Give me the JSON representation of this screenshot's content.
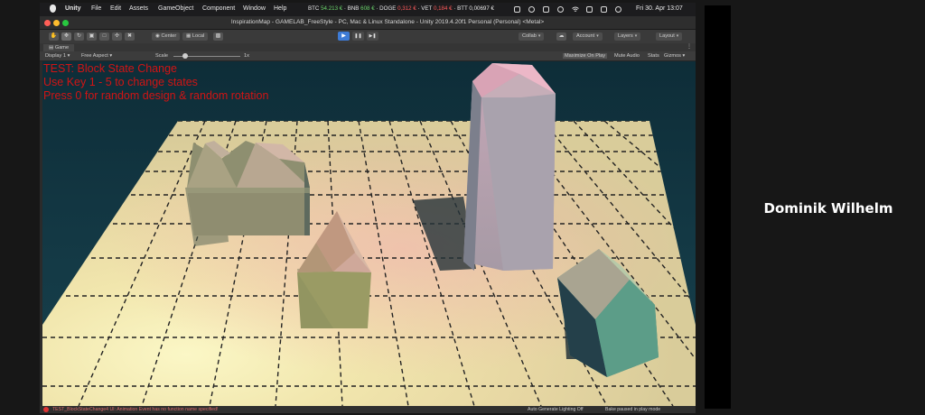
{
  "menubar": {
    "app": "Unity",
    "menus": [
      "File",
      "Edit",
      "Assets",
      "GameObject",
      "Component",
      "Window",
      "Help"
    ],
    "tickers": [
      {
        "symbol": "BTC",
        "value": "54.213 €",
        "trend": "up"
      },
      {
        "symbol": "BNB",
        "value": "608 €",
        "trend": "up"
      },
      {
        "symbol": "DOGE",
        "value": "0,312 €",
        "trend": "down"
      },
      {
        "symbol": "VET",
        "value": "0,184 €",
        "trend": "down"
      },
      {
        "symbol": "BTT",
        "value": "0,00697 €",
        "trend": "neutral"
      }
    ],
    "clock": "Fri 30. Apr 13:07"
  },
  "window": {
    "title": "InspirationMap - GAMELAB_FreeStyle - PC, Mac & Linux Standalone - Unity 2019.4.20f1 Personal (Personal) <Metal>"
  },
  "toolbar": {
    "pivot_label": "Center",
    "space_label": "Local",
    "play_icon": "▶",
    "pause_icon": "❚❚",
    "step_icon": "▶❚",
    "collab_label": "Collab",
    "account_label": "Account",
    "layers_label": "Layers",
    "layout_label": "Layout"
  },
  "game_tab": {
    "tab_label": "Game",
    "display": "Display 1",
    "aspect": "Free Aspect",
    "scale_label": "Scale",
    "scale_value": "1x",
    "maximize": "Maximize On Play",
    "mute": "Mute Audio",
    "stats": "Stats",
    "gizmos": "Gizmos"
  },
  "hud": {
    "line1": "TEST: Block State Change",
    "line2": "Use Key 1 - 5 to change states",
    "line3": "Press 0 for random design & random rotation"
  },
  "statusbar": {
    "error": "TEST_BlockStateChange4 UI: Animation Event has no function name specified!",
    "lighting": "Auto Generate Lighting Off",
    "bake": "Bake paused in play mode"
  },
  "participant": {
    "name": "Dominik Wilhelm"
  },
  "colors": {
    "hud_text": "#d11414",
    "play_active": "#3d7bd6",
    "sky": "#143a46",
    "floor": "#efe7ad"
  }
}
